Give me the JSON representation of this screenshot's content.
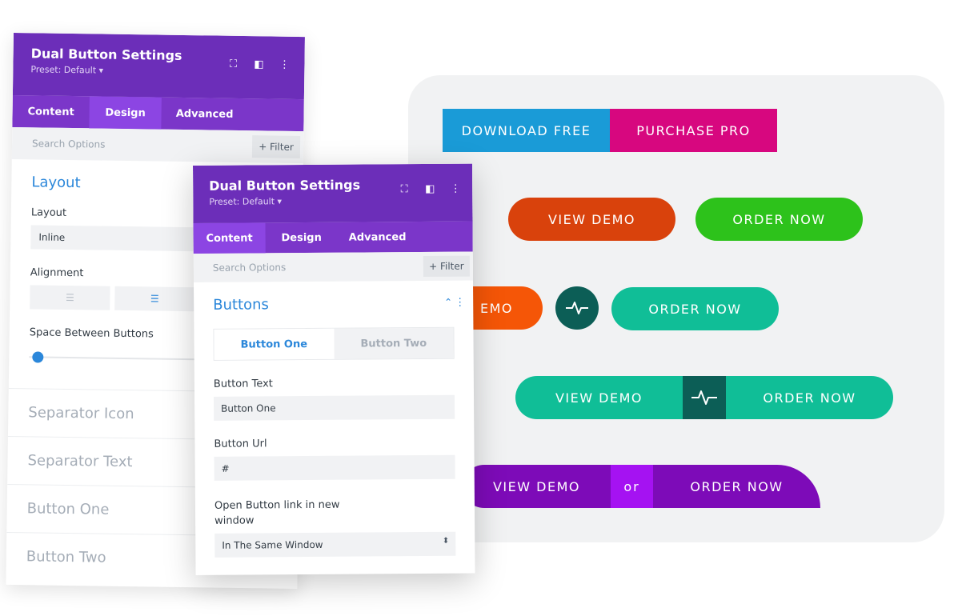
{
  "back_panel": {
    "title": "Dual Button Settings",
    "preset": "Preset: Default ▾",
    "tabs": [
      "Content",
      "Design",
      "Advanced"
    ],
    "search_placeholder": "Search Options",
    "filter_label": "+ Filter",
    "section_title": "Layout",
    "layout_label": "Layout",
    "layout_value": "Inline",
    "alignment_label": "Alignment",
    "space_label": "Space Between Buttons",
    "slider_value": 0,
    "collapsed_sections": [
      "Separator Icon",
      "Separator Text",
      "Button One",
      "Button Two"
    ]
  },
  "front_panel": {
    "title": "Dual Button Settings",
    "preset": "Preset: Default ▾",
    "tabs": [
      "Content",
      "Design",
      "Advanced"
    ],
    "search_placeholder": "Search Options",
    "filter_label": "+ Filter",
    "section_title": "Buttons",
    "subtabs": [
      "Button One",
      "Button Two"
    ],
    "button_text_label": "Button Text",
    "button_text_value": "Button One",
    "button_url_label": "Button Url",
    "button_url_value": "#",
    "open_link_label": "Open Button link in new window",
    "open_link_value": "In The Same Window"
  },
  "preview": {
    "row1": [
      "DOWNLOAD FREE",
      "PURCHASE  PRO"
    ],
    "row2": [
      "VIEW DEMO",
      "ORDER NOW"
    ],
    "row3": [
      "EMO",
      "ORDER NOW"
    ],
    "row4": [
      "VIEW DEMO",
      "ORDER NOW"
    ],
    "row5": [
      "VIEW DEMO",
      "or",
      "ORDER NOW"
    ]
  },
  "colors": {
    "purple_header": "#6c2eb9",
    "accent_blue": "#2b87da",
    "download": "#1a9bd7",
    "purchase": "#d7077f",
    "view_demo_orange": "#d9420c",
    "order_green": "#2dc21b",
    "teal": "#10be97",
    "dark_teal": "#0c5e56",
    "purple_btn": "#7d0bb8"
  }
}
